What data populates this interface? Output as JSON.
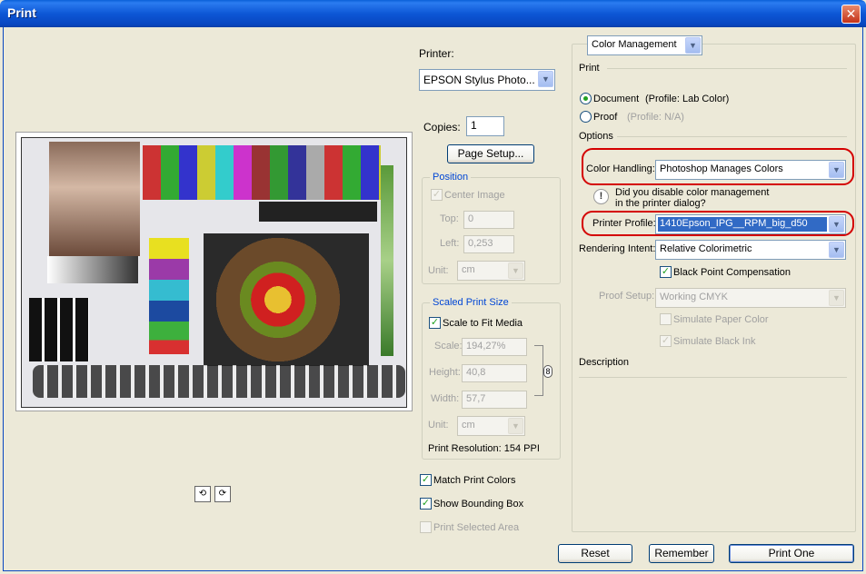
{
  "window": {
    "title": "Print",
    "close_glyph": "✕"
  },
  "printer": {
    "label": "Printer:",
    "value": "EPSON Stylus Photo...",
    "copies_label": "Copies:",
    "copies_value": "1",
    "page_setup_label": "Page Setup..."
  },
  "position": {
    "legend": "Position",
    "center_image_label": "Center Image",
    "top_label": "Top:",
    "top_value": "0",
    "left_label": "Left:",
    "left_value": "0,253",
    "unit_label": "Unit:",
    "unit_value": "cm"
  },
  "scaled": {
    "legend": "Scaled Print Size",
    "scale_to_fit_label": "Scale to Fit Media",
    "scale_label": "Scale:",
    "scale_value": "194,27%",
    "height_label": "Height:",
    "height_value": "40,8",
    "width_label": "Width:",
    "width_value": "57,7",
    "unit_label": "Unit:",
    "unit_value": "cm",
    "resolution": "Print Resolution: 154 PPI"
  },
  "bottom_options": {
    "match_colors": "Match Print Colors",
    "bounding_box": "Show Bounding Box",
    "selected_area": "Print Selected Area"
  },
  "color_mgmt": {
    "mode": "Color Management",
    "print_heading": "Print",
    "document_label": "Document",
    "document_profile": "(Profile: Lab Color)",
    "proof_label": "Proof",
    "proof_profile": "(Profile: N/A)",
    "options_heading": "Options",
    "color_handling_label": "Color Handling:",
    "color_handling_value": "Photoshop Manages Colors",
    "warning_text_1": "Did you disable color management",
    "warning_text_2": "in the printer dialog?",
    "printer_profile_label": "Printer Profile:",
    "printer_profile_value": "1410Epson_IPG__RPM_big_d50",
    "rendering_label": "Rendering Intent:",
    "rendering_value": "Relative Colorimetric",
    "bpc_label": "Black Point Compensation",
    "proof_setup_label": "Proof Setup:",
    "proof_setup_value": "Working CMYK",
    "simulate_paper": "Simulate Paper Color",
    "simulate_ink": "Simulate Black Ink",
    "description_heading": "Description"
  },
  "buttons": {
    "reset": "Reset",
    "remember": "Remember",
    "print_one": "Print One"
  },
  "icons": {
    "check": "✓",
    "arrow": "▼",
    "warn": "!",
    "link": "8"
  },
  "colors": {
    "accent": "#0046d5",
    "highlight": "#316ac5",
    "oval": "#d40000"
  }
}
